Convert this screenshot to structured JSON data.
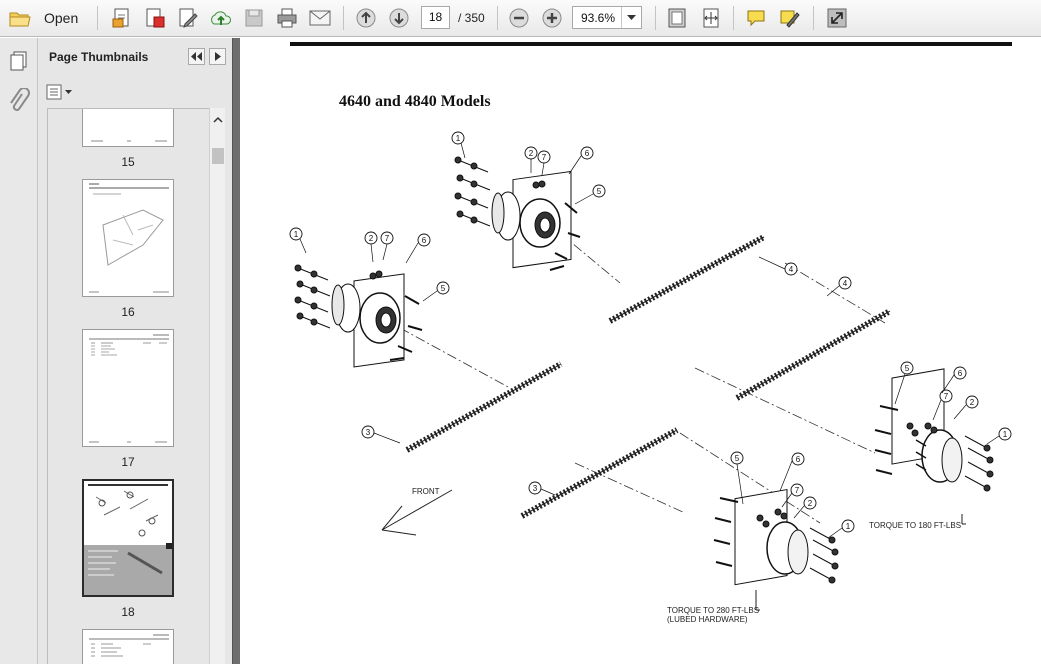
{
  "toolbar": {
    "open_label": "Open",
    "current_page": "18",
    "page_total": "/ 350",
    "zoom": "93.6%"
  },
  "sidebar": {
    "title": "Page Thumbnails",
    "thumbnails": [
      {
        "page": "15"
      },
      {
        "page": "16"
      },
      {
        "page": "17"
      },
      {
        "page": "18",
        "selected": true
      }
    ]
  },
  "document": {
    "section_title": "4640 and 4840 Models",
    "callouts": [
      "1",
      "2",
      "7",
      "6",
      "5",
      "4",
      "3"
    ],
    "front_label": "FRONT",
    "torque_180": "TORQUE TO 180 FT-LBS",
    "torque_280": "TORQUE TO 280 FT-LBS",
    "torque_280_note": "(LUBED HARDWARE)"
  },
  "icons": [
    "open-folder-icon",
    "create-pdf-icon",
    "edit-pdf-icon",
    "sign-icon",
    "upload-icon",
    "save-icon",
    "print-icon",
    "email-icon",
    "prev-page-icon",
    "next-page-icon",
    "zoom-out-icon",
    "zoom-in-icon",
    "fit-page-icon",
    "fit-width-icon",
    "comment-icon",
    "highlight-icon",
    "expand-icon"
  ]
}
